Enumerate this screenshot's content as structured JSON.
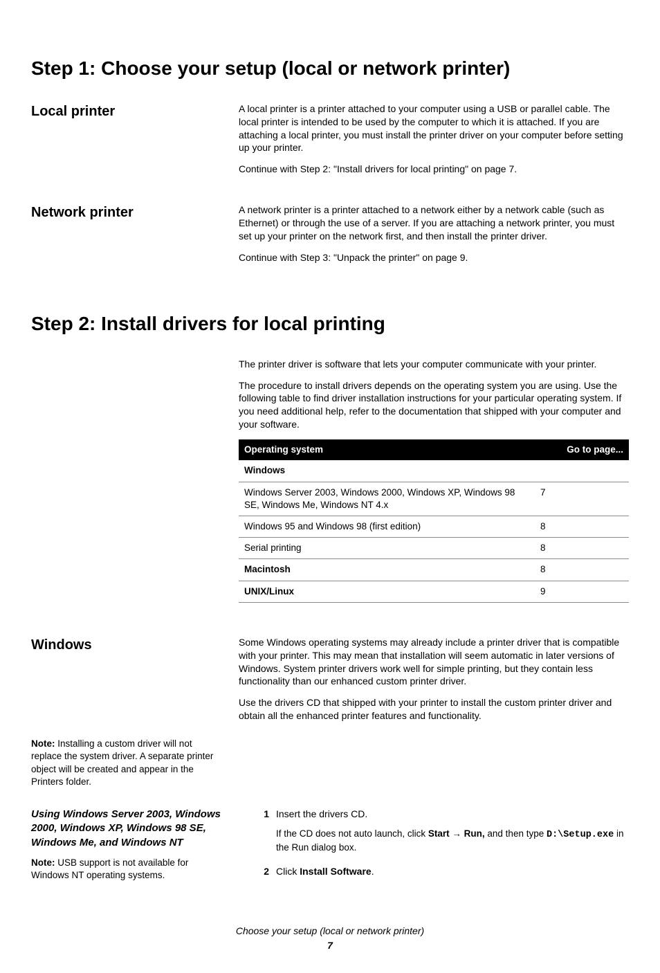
{
  "step1": {
    "heading": "Step 1: Choose your setup (local or network printer)",
    "local": {
      "title": "Local printer",
      "p1": "A local printer is a printer attached to your computer using a USB or parallel cable. The local printer is intended to be used by the computer to which it is attached. If you are attaching a local printer, you must install the printer driver on your computer before setting up your printer.",
      "p2": "Continue with Step 2: \"Install drivers for local printing\" on page 7."
    },
    "network": {
      "title": "Network printer",
      "p1": "A network printer is a printer attached to a network either by a network cable (such as Ethernet) or through the use of a server. If you are attaching a network printer, you must set up your printer on the network first, and then install the printer driver.",
      "p2": "Continue with Step 3: \"Unpack the printer\" on page 9."
    }
  },
  "step2": {
    "heading": "Step 2: Install drivers for local printing",
    "intro1": "The printer driver is software that lets your computer communicate with your printer.",
    "intro2": "The procedure to install drivers depends on the operating system you are using. Use the following table to find driver installation instructions for your particular operating system. If you need additional help, refer to the documentation that shipped with your computer and your software.",
    "table": {
      "h1": "Operating system",
      "h2": "Go to page...",
      "rows": [
        {
          "os": "Windows",
          "page": "",
          "bold": true
        },
        {
          "os": "Windows Server 2003, Windows 2000, Windows XP, Windows 98 SE, Windows Me, Windows NT 4.x",
          "page": "7",
          "bold": false
        },
        {
          "os": "Windows 95 and Windows 98 (first edition)",
          "page": "8",
          "bold": false
        },
        {
          "os": "Serial printing",
          "page": "8",
          "bold": false
        },
        {
          "os": "Macintosh",
          "page": "8",
          "bold": true
        },
        {
          "os": "UNIX/Linux",
          "page": "9",
          "bold": true
        }
      ]
    },
    "windows": {
      "title": "Windows",
      "p1": "Some Windows operating systems may already include a printer driver that is compatible with your printer. This may mean that installation will seem automatic in later versions of Windows. System printer drivers work well for simple printing, but they contain less functionality than our enhanced custom printer driver.",
      "p2": "Use the drivers CD that shipped with your printer to install the custom printer driver and obtain all the enhanced printer features and functionality.",
      "note1_label": "Note:",
      "note1": " Installing a custom driver will not replace the system driver. A separate printer object will be created and appear in the Printers folder.",
      "sub_heading": "Using Windows Server 2003, Windows 2000, Windows XP, Windows 98 SE, Windows Me, and Windows NT",
      "note2_label": "Note:",
      "note2": " USB support is not available for Windows NT operating systems.",
      "steps": {
        "s1_num": "1",
        "s1_text": "Insert the drivers CD.",
        "s1_sub_a": "If the CD does not auto launch, click ",
        "s1_sub_b": "Start",
        "s1_sub_arrow": " → ",
        "s1_sub_c": "Run,",
        "s1_sub_d": " and then type ",
        "s1_sub_e": "D:\\Setup.exe",
        "s1_sub_f": " in the Run dialog box.",
        "s2_num": "2",
        "s2_a": "Click ",
        "s2_b": "Install Software",
        "s2_c": "."
      }
    }
  },
  "footer": {
    "title": "Choose your setup (local or network printer)",
    "page": "7"
  }
}
